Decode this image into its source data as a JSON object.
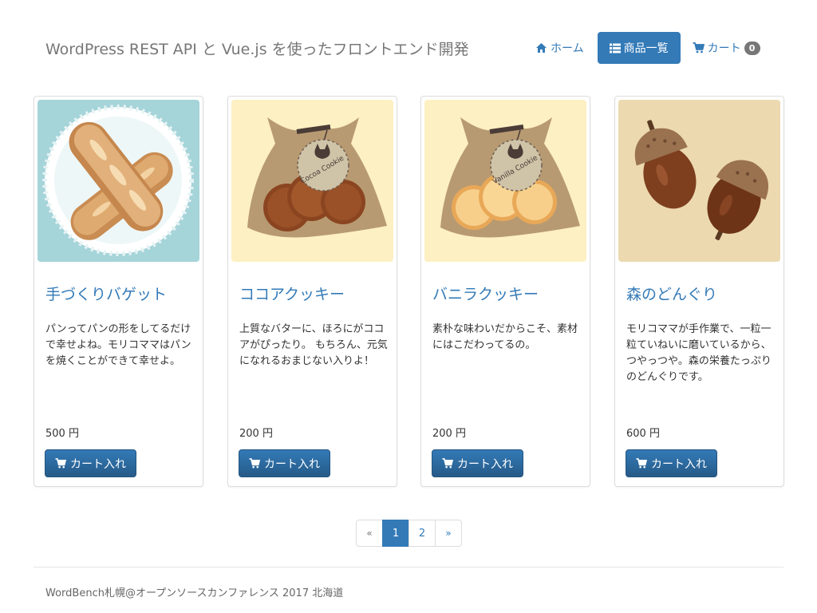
{
  "navbar": {
    "brand": "WordPress REST API と Vue.js を使ったフロントエンド開発",
    "home_label": "ホーム",
    "products_label": "商品一覧",
    "cart_label": "カート",
    "cart_count": "0"
  },
  "products": [
    {
      "title": "手づくりバゲット",
      "description": "パンってパンの形をしてるだけで幸せよね。モリコママはパンを焼くことができて幸せよ。",
      "price": "500 円",
      "button_label": "カート入れ",
      "image": "baguette"
    },
    {
      "title": "ココアクッキー",
      "description": "上質なバターに、ほろにがココアがぴったり。 もちろん、元気になれるおまじない入りよ！",
      "price": "200 円",
      "button_label": "カート入れ",
      "image": "cocoa-cookie-bag",
      "tag_text": "Cocoa Cookie"
    },
    {
      "title": "バニラクッキー",
      "description": "素朴な味わいだからこそ、素材にはこだわってるの。",
      "price": "200 円",
      "button_label": "カート入れ",
      "image": "vanilla-cookie-bag",
      "tag_text": "Vanilla Cookie"
    },
    {
      "title": "森のどんぐり",
      "description": "モリコママが手作業で、一粒一粒ていねいに磨いているから、つやっつや。森の栄養たっぷりのどんぐりです。",
      "price": "600 円",
      "button_label": "カート入れ",
      "image": "acorns"
    }
  ],
  "pagination": {
    "prev": "«",
    "pages": [
      "1",
      "2"
    ],
    "active": "1",
    "next": "»"
  },
  "footer": {
    "text": "WordBench札幌@オープンソースカンファレンス 2017 北海道"
  },
  "colors": {
    "primary": "#337ab7",
    "baguette_bg": "#a5d4d9",
    "cookie_bg": "#fdf0c2",
    "acorn_bg": "#ecd9b0"
  }
}
